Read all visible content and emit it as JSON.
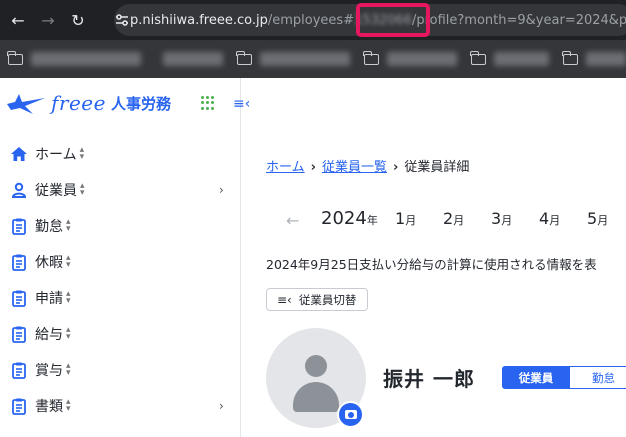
{
  "browser": {
    "url_host": "p.nishiiwa.freee.co.jp",
    "url_path_prefix": "/employees#",
    "url_employee_id": "1532066",
    "url_path_suffix": "/profile?month=9&year=2024&pa"
  },
  "sidebar": {
    "logo_text": "freee",
    "logo_sub": "人事労務",
    "items": [
      {
        "label": "ホーム",
        "icon": "home-icon",
        "has_children": false
      },
      {
        "label": "従業員",
        "icon": "person-icon",
        "has_children": true
      },
      {
        "label": "勤怠",
        "icon": "clipboard-icon",
        "has_children": false
      },
      {
        "label": "休暇",
        "icon": "clipboard-icon",
        "has_children": false
      },
      {
        "label": "申請",
        "icon": "clipboard-icon",
        "has_children": false
      },
      {
        "label": "給与",
        "icon": "clipboard-icon",
        "has_children": false
      },
      {
        "label": "賞与",
        "icon": "clipboard-icon",
        "has_children": false
      },
      {
        "label": "書類",
        "icon": "clipboard-icon",
        "has_children": true
      }
    ]
  },
  "breadcrumb": {
    "home": "ホーム",
    "employees": "従業員一覧",
    "current": "従業員詳細"
  },
  "calendar": {
    "year": "2024",
    "year_suffix": "年",
    "month_suffix": "月",
    "months": [
      "1",
      "2",
      "3",
      "4",
      "5"
    ]
  },
  "notice": "2024年9月25日支払い分給与の計算に使用される情報を表",
  "switch_button": "従業員切替",
  "employee": {
    "name": "振井 一郎"
  },
  "tabs": {
    "employee": "従業員",
    "attendance": "勤怠"
  },
  "colors": {
    "accent": "#2864f0",
    "highlight": "#e6175e"
  }
}
